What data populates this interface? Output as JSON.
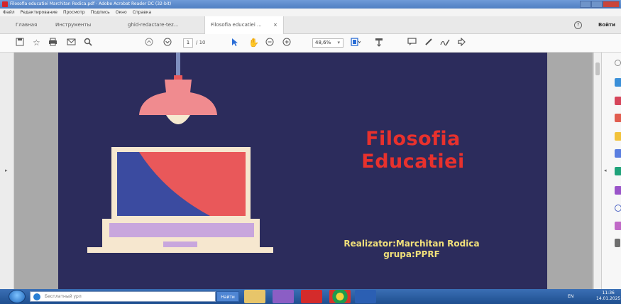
{
  "window": {
    "title": "Filosofia educatiei Marchitan Rodica.pdf - Adobe Acrobat Reader DC (32-bit)"
  },
  "menubar": {
    "items": [
      "Файл",
      "Редактирование",
      "Просмотр",
      "Подпись",
      "Окно",
      "Справка"
    ]
  },
  "tabbar": {
    "home_label": "Главная",
    "tools_label": "Инструменты",
    "tabs": [
      {
        "label": "ghid-redactare-tez..."
      },
      {
        "label": "Filosofia educatiei ...",
        "close": "×"
      }
    ],
    "help_label": "?",
    "signin_label": "Войти"
  },
  "toolbar": {
    "current_page": "1",
    "total_pages": "/ 10",
    "zoom": "48,6%"
  },
  "slide": {
    "title_line1": "Filosofia",
    "title_line2": "Educatiei",
    "author_line1": "Realizator:Marchitan Rodica",
    "author_line2": "grupa:PPRF",
    "colors": {
      "background": "#2c2c5c",
      "title": "#e8312d",
      "author": "#f1e07a",
      "lamp": "#f08b8f",
      "laptop_body": "#f6e7cf",
      "screen_red": "#e9585a",
      "screen_blue": "#3b4ba0",
      "keyboard": "#c8a6dd"
    }
  },
  "taskbar": {
    "search_placeholder": "Бесплатный урл",
    "find_label": "Найти",
    "tray_lang": "EN",
    "time": "11:36",
    "date": "14.01.2025"
  }
}
